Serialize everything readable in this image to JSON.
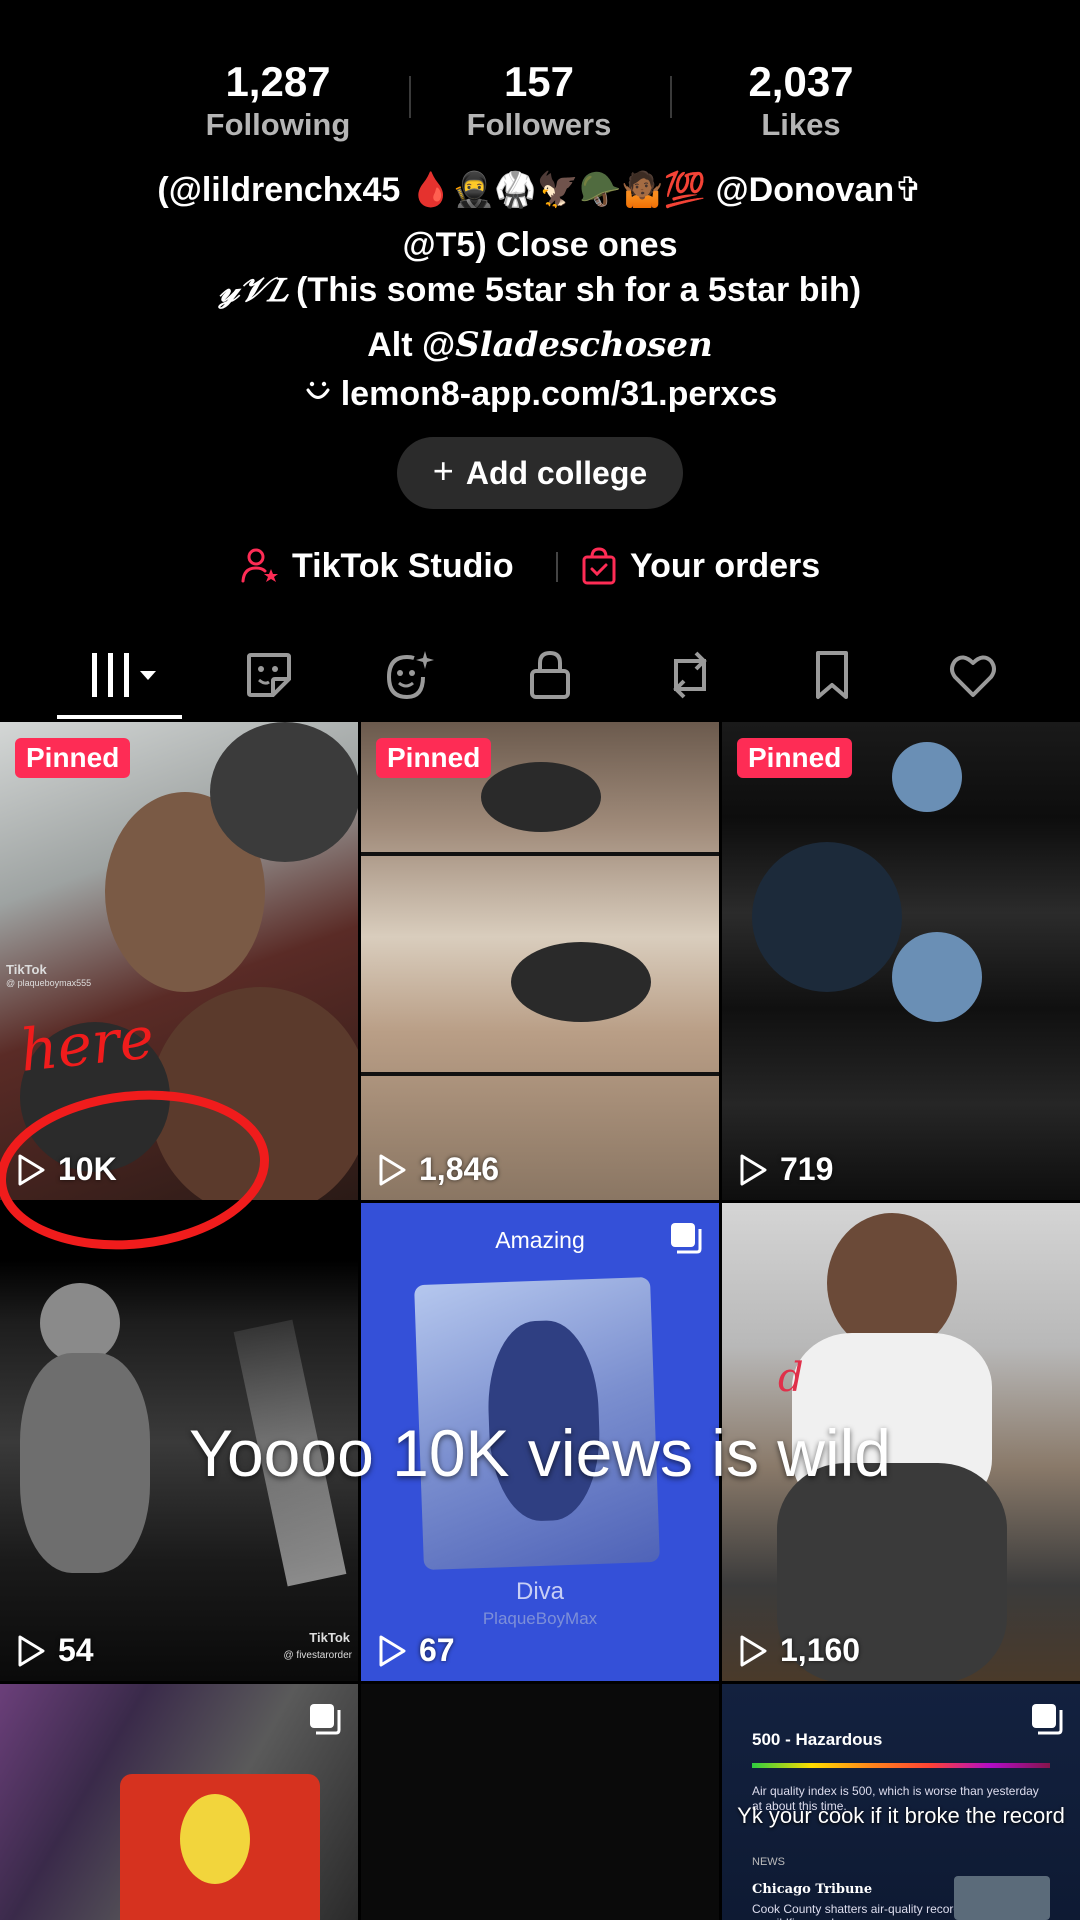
{
  "stats": {
    "following": {
      "value": "1,287",
      "label": "Following"
    },
    "followers": {
      "value": "157",
      "label": "Followers"
    },
    "likes": {
      "value": "2,037",
      "label": "Likes"
    }
  },
  "bio": {
    "line1_text": "(@lildrenchx45",
    "line1_emojis": "🩸🥷🥋🦅🪖🤷🏾💯",
    "line1_end": "@Donovan✞",
    "line2": "@T5) Close ones",
    "line3_script": "𝓎𝒱𝐿",
    "line3_text": "(This some 5star sh for a 5star bih)",
    "line4_prefix": "Alt @",
    "line4_script": "Sladeschosen",
    "link": "lemon8-app.com/31.perxcs"
  },
  "add_college": {
    "plus": "+",
    "label": "Add college"
  },
  "tools": {
    "studio_label": "TikTok Studio",
    "orders_label": "Your orders",
    "accent": "#fe2c55"
  },
  "tabs": [
    "videos-icon",
    "sticker-icon",
    "ai-face-icon",
    "lock-icon",
    "repost-icon",
    "bookmark-icon",
    "heart-icon"
  ],
  "grid": {
    "pinned_label": "Pinned",
    "videos": [
      {
        "views": "10K",
        "pinned": true,
        "watermark": "TikTok",
        "watermark_user": "@ plaqueboymax555"
      },
      {
        "views": "1,846",
        "pinned": true
      },
      {
        "views": "719",
        "pinned": true
      },
      {
        "views": "54",
        "watermark": "TikTok",
        "watermark_user": "@ fivestarorder"
      },
      {
        "views": "67",
        "title": "Amazing",
        "caption": "Diva",
        "artist": "PlaqueBoyMax"
      },
      {
        "views": "1,160"
      },
      {},
      {},
      {
        "aqi": "500 - Hazardous",
        "aqi_text": "Air quality index is 500, which is worse than yesterday at about this time.",
        "overlay": "Yk your cook if it broke the record",
        "news": "NEWS",
        "paper": "Chicago Tribune",
        "headline": "Cook County shatters air-quality record as wildfire smoke"
      }
    ]
  },
  "overlays": {
    "caption": "Yoooo 10K views is wild",
    "here": "here",
    "d": "d"
  }
}
